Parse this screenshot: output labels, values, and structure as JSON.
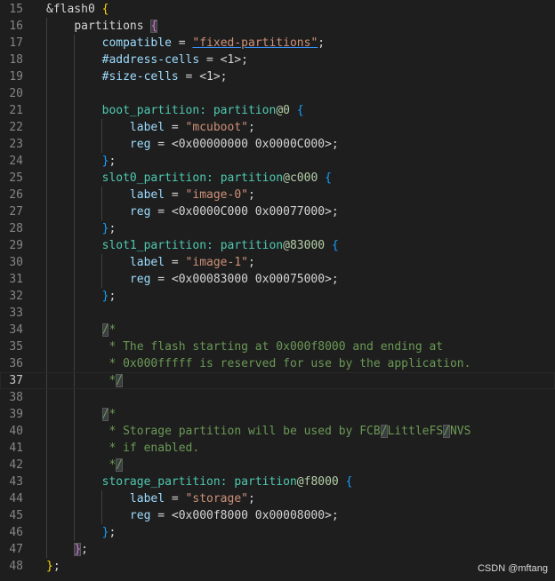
{
  "editor": {
    "current_line": 37,
    "colors": {
      "background": "#1e1e1e",
      "line_number": "#858585",
      "comment": "#6a9955",
      "property": "#9cdcfe",
      "string": "#ce9178",
      "node": "#4ec9b0",
      "bracket_gold": "#ffd700",
      "bracket_violet": "#da70d6",
      "bracket_blue": "#179fff"
    },
    "lines": [
      {
        "num": "15",
        "tokens": [
          {
            "t": "&flash0 ",
            "c": "def"
          },
          {
            "t": "{",
            "c": "br1"
          }
        ]
      },
      {
        "num": "16",
        "tokens": [
          {
            "t": "    "
          },
          {
            "t": "partitions ",
            "c": "def"
          },
          {
            "t": "{",
            "c": "br2",
            "hl": true
          }
        ]
      },
      {
        "num": "17",
        "tokens": [
          {
            "t": "        "
          },
          {
            "t": "compatible",
            "c": "prop"
          },
          {
            "t": " = ",
            "c": "def"
          },
          {
            "t": "\"fixed-partitions\"",
            "c": "strlink"
          },
          {
            "t": ";",
            "c": "def"
          }
        ]
      },
      {
        "num": "18",
        "tokens": [
          {
            "t": "        "
          },
          {
            "t": "#address-cells",
            "c": "prop"
          },
          {
            "t": " = <1>;",
            "c": "def"
          }
        ]
      },
      {
        "num": "19",
        "tokens": [
          {
            "t": "        "
          },
          {
            "t": "#size-cells",
            "c": "prop"
          },
          {
            "t": " = <1>;",
            "c": "def"
          }
        ]
      },
      {
        "num": "20",
        "tokens": []
      },
      {
        "num": "21",
        "tokens": [
          {
            "t": "        "
          },
          {
            "t": "boot_partition: ",
            "c": "node"
          },
          {
            "t": "partition",
            "c": "node"
          },
          {
            "t": "@0 ",
            "c": "num"
          },
          {
            "t": "{",
            "c": "br3"
          }
        ]
      },
      {
        "num": "22",
        "tokens": [
          {
            "t": "            "
          },
          {
            "t": "label",
            "c": "prop"
          },
          {
            "t": " = ",
            "c": "def"
          },
          {
            "t": "\"mcuboot\"",
            "c": "str"
          },
          {
            "t": ";",
            "c": "def"
          }
        ]
      },
      {
        "num": "23",
        "tokens": [
          {
            "t": "            "
          },
          {
            "t": "reg",
            "c": "prop"
          },
          {
            "t": " = <0x00000000 0x0000C000>;",
            "c": "def"
          }
        ]
      },
      {
        "num": "24",
        "tokens": [
          {
            "t": "        "
          },
          {
            "t": "}",
            "c": "br3"
          },
          {
            "t": ";",
            "c": "def"
          }
        ]
      },
      {
        "num": "25",
        "tokens": [
          {
            "t": "        "
          },
          {
            "t": "slot0_partition: ",
            "c": "node"
          },
          {
            "t": "partition",
            "c": "node"
          },
          {
            "t": "@c000 ",
            "c": "num"
          },
          {
            "t": "{",
            "c": "br3"
          }
        ]
      },
      {
        "num": "26",
        "tokens": [
          {
            "t": "            "
          },
          {
            "t": "label",
            "c": "prop"
          },
          {
            "t": " = ",
            "c": "def"
          },
          {
            "t": "\"image-0\"",
            "c": "str"
          },
          {
            "t": ";",
            "c": "def"
          }
        ]
      },
      {
        "num": "27",
        "tokens": [
          {
            "t": "            "
          },
          {
            "t": "reg",
            "c": "prop"
          },
          {
            "t": " = <0x0000C000 0x00077000>;",
            "c": "def"
          }
        ]
      },
      {
        "num": "28",
        "tokens": [
          {
            "t": "        "
          },
          {
            "t": "}",
            "c": "br3"
          },
          {
            "t": ";",
            "c": "def"
          }
        ]
      },
      {
        "num": "29",
        "tokens": [
          {
            "t": "        "
          },
          {
            "t": "slot1_partition: ",
            "c": "node"
          },
          {
            "t": "partition",
            "c": "node"
          },
          {
            "t": "@83000 ",
            "c": "num"
          },
          {
            "t": "{",
            "c": "br3"
          }
        ]
      },
      {
        "num": "30",
        "tokens": [
          {
            "t": "            "
          },
          {
            "t": "label",
            "c": "prop"
          },
          {
            "t": " = ",
            "c": "def"
          },
          {
            "t": "\"image-1\"",
            "c": "str"
          },
          {
            "t": ";",
            "c": "def"
          }
        ]
      },
      {
        "num": "31",
        "tokens": [
          {
            "t": "            "
          },
          {
            "t": "reg",
            "c": "prop"
          },
          {
            "t": " = <0x00083000 0x00075000>;",
            "c": "def"
          }
        ]
      },
      {
        "num": "32",
        "tokens": [
          {
            "t": "        "
          },
          {
            "t": "}",
            "c": "br3"
          },
          {
            "t": ";",
            "c": "def"
          }
        ]
      },
      {
        "num": "33",
        "tokens": []
      },
      {
        "num": "34",
        "tokens": [
          {
            "t": "        "
          },
          {
            "t": "/",
            "c": "cmt",
            "hl": true
          },
          {
            "t": "*",
            "c": "cmt"
          }
        ]
      },
      {
        "num": "35",
        "tokens": [
          {
            "t": "        "
          },
          {
            "t": " * The flash starting at 0x000f8000 and ending at",
            "c": "cmt"
          }
        ]
      },
      {
        "num": "36",
        "tokens": [
          {
            "t": "        "
          },
          {
            "t": " * 0x000fffff is reserved for use by the application.",
            "c": "cmt"
          }
        ]
      },
      {
        "num": "37",
        "tokens": [
          {
            "t": "        "
          },
          {
            "t": " *",
            "c": "cmt"
          },
          {
            "t": "/",
            "c": "cmt",
            "hl": true
          }
        ]
      },
      {
        "num": "38",
        "tokens": []
      },
      {
        "num": "39",
        "tokens": [
          {
            "t": "        "
          },
          {
            "t": "/",
            "c": "cmt",
            "hl": true
          },
          {
            "t": "*",
            "c": "cmt"
          }
        ]
      },
      {
        "num": "40",
        "tokens": [
          {
            "t": "        "
          },
          {
            "t": " * Storage partition will be used by FCB",
            "c": "cmt"
          },
          {
            "t": "/",
            "c": "cmt",
            "hl": true
          },
          {
            "t": "LittleFS",
            "c": "cmt"
          },
          {
            "t": "/",
            "c": "cmt",
            "hl": true
          },
          {
            "t": "NVS",
            "c": "cmt"
          }
        ]
      },
      {
        "num": "41",
        "tokens": [
          {
            "t": "        "
          },
          {
            "t": " * if enabled.",
            "c": "cmt"
          }
        ]
      },
      {
        "num": "42",
        "tokens": [
          {
            "t": "        "
          },
          {
            "t": " *",
            "c": "cmt"
          },
          {
            "t": "/",
            "c": "cmt",
            "hl": true
          }
        ]
      },
      {
        "num": "43",
        "tokens": [
          {
            "t": "        "
          },
          {
            "t": "storage_partition: ",
            "c": "node"
          },
          {
            "t": "partition",
            "c": "node"
          },
          {
            "t": "@f8000 ",
            "c": "num"
          },
          {
            "t": "{",
            "c": "br3"
          }
        ]
      },
      {
        "num": "44",
        "tokens": [
          {
            "t": "            "
          },
          {
            "t": "label",
            "c": "prop"
          },
          {
            "t": " = ",
            "c": "def"
          },
          {
            "t": "\"storage\"",
            "c": "str"
          },
          {
            "t": ";",
            "c": "def"
          }
        ]
      },
      {
        "num": "45",
        "tokens": [
          {
            "t": "            "
          },
          {
            "t": "reg",
            "c": "prop"
          },
          {
            "t": " = <0x000f8000 0x00008000>;",
            "c": "def"
          }
        ]
      },
      {
        "num": "46",
        "tokens": [
          {
            "t": "        "
          },
          {
            "t": "}",
            "c": "br3"
          },
          {
            "t": ";",
            "c": "def"
          }
        ]
      },
      {
        "num": "47",
        "tokens": [
          {
            "t": "    "
          },
          {
            "t": "}",
            "c": "br2",
            "hl": true
          },
          {
            "t": ";",
            "c": "def"
          }
        ]
      },
      {
        "num": "48",
        "tokens": [
          {
            "t": "}",
            "c": "br1"
          },
          {
            "t": ";",
            "c": "def"
          }
        ]
      }
    ]
  },
  "watermark": "CSDN @mftang"
}
